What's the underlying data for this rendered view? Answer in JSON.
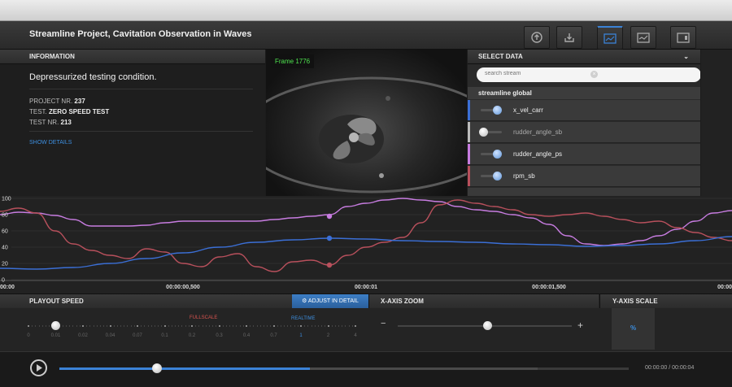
{
  "header": {
    "title": "Streamline Project, Cavitation Observation in Waves",
    "buttons": [
      {
        "icon": "upload-icon"
      },
      {
        "icon": "download-icon"
      },
      {
        "icon": "chart-panel-icon"
      },
      {
        "icon": "chart-line-icon"
      },
      {
        "icon": "window-icon"
      }
    ]
  },
  "info": {
    "heading": "INFORMATION",
    "headline": "Depressurized testing condition.",
    "project_label": "PROJECT NR. ",
    "project_value": "237",
    "test_label": "TEST. ",
    "test_value": "ZERO SPEED TEST",
    "testnr_label": "TEST NR. ",
    "testnr_value": "213",
    "show_details": "SHOW DETAILS"
  },
  "video": {
    "frame_label": "Frame 1776"
  },
  "select_data": {
    "heading": "SELECT DATA",
    "search_placeholder": "search stream",
    "group": "streamline global",
    "streams": [
      {
        "name": "x_vel_carr",
        "color": "#3b6fd6",
        "on": true
      },
      {
        "name": "rudder_angle_sb",
        "color": "#bbbbbb",
        "on": false
      },
      {
        "name": "rudder_angle_ps",
        "color": "#c77ce0",
        "on": true
      },
      {
        "name": "rpm_sb",
        "color": "#b8505c",
        "on": true
      }
    ]
  },
  "chart_data": {
    "type": "line",
    "ylim": [
      0,
      100
    ],
    "yticks": [
      "100",
      "80",
      "60",
      "40",
      "20",
      "0"
    ],
    "xticks": [
      "00:00",
      "00:00:00,500",
      "00:00:01",
      "00:00:01,500",
      "00:00"
    ],
    "x_range": [
      0,
      2
    ],
    "series": [
      {
        "name": "rudder_angle_ps",
        "color": "#c77ce0",
        "x": [
          0,
          0.05,
          0.1,
          0.15,
          0.2,
          0.25,
          0.3,
          0.35,
          0.4,
          0.45,
          0.5,
          0.55,
          0.6,
          0.65,
          0.7,
          0.75,
          0.8,
          0.85,
          0.9,
          0.95,
          1.0,
          1.05,
          1.1,
          1.15,
          1.2,
          1.25,
          1.3,
          1.35,
          1.4,
          1.45,
          1.5,
          1.55,
          1.6,
          1.65,
          1.7,
          1.75,
          1.8,
          1.85,
          1.9,
          1.95,
          2.0
        ],
        "y": [
          80,
          83,
          82,
          79,
          74,
          66,
          66,
          66,
          67,
          70,
          72,
          72,
          72,
          72,
          72,
          74,
          76,
          78,
          80,
          90,
          94,
          98,
          100,
          98,
          96,
          90,
          86,
          84,
          80,
          76,
          68,
          54,
          44,
          42,
          44,
          48,
          54,
          62,
          72,
          82,
          85
        ]
      },
      {
        "name": "rpm_sb",
        "color": "#b8505c",
        "x": [
          0,
          0.05,
          0.1,
          0.15,
          0.2,
          0.25,
          0.3,
          0.35,
          0.4,
          0.45,
          0.5,
          0.55,
          0.6,
          0.65,
          0.7,
          0.75,
          0.8,
          0.85,
          0.9,
          0.95,
          1.0,
          1.05,
          1.1,
          1.15,
          1.2,
          1.25,
          1.3,
          1.35,
          1.4,
          1.45,
          1.5,
          1.55,
          1.6,
          1.65,
          1.7,
          1.75,
          1.8,
          1.85,
          1.9,
          1.95,
          2.0
        ],
        "y": [
          84,
          88,
          82,
          60,
          44,
          36,
          30,
          26,
          38,
          34,
          20,
          16,
          28,
          32,
          16,
          10,
          22,
          24,
          18,
          30,
          40,
          46,
          52,
          70,
          92,
          98,
          94,
          90,
          86,
          80,
          78,
          80,
          82,
          78,
          74,
          70,
          72,
          64,
          58,
          52,
          48
        ]
      },
      {
        "name": "x_vel_carr",
        "color": "#3b6fd6",
        "x": [
          0,
          0.1,
          0.2,
          0.3,
          0.4,
          0.5,
          0.6,
          0.7,
          0.8,
          0.9,
          1.0,
          1.1,
          1.2,
          1.3,
          1.4,
          1.5,
          1.6,
          1.7,
          1.8,
          1.9,
          2.0
        ],
        "y": [
          14,
          13,
          15,
          20,
          26,
          33,
          40,
          46,
          49,
          51,
          50,
          48,
          47,
          46,
          44,
          43,
          41,
          42,
          44,
          48,
          53
        ]
      }
    ],
    "markers": [
      {
        "series": "rudder_angle_ps",
        "x": 0.9,
        "y": 78
      },
      {
        "series": "x_vel_carr",
        "x": 0.9,
        "y": 51
      },
      {
        "series": "rpm_sb",
        "x": 0.9,
        "y": 18
      }
    ]
  },
  "controls": {
    "playout_speed": "PLAYOUT SPEED",
    "adjust_label": "ADJUST IN DETAIL",
    "fullscale": "FULLSCALE",
    "realtime": "REALTIME",
    "speed_ticks": [
      "0",
      "0.01",
      "0.02",
      "0.04",
      "0.07",
      "0.1",
      "0.2",
      "0.3",
      "0.4",
      "0.7",
      "1",
      "2",
      "4"
    ],
    "speed_selected": "0.01",
    "xaxis_zoom": "X-AXIS ZOOM",
    "minus": "−",
    "plus": "+",
    "zoom_level": 0.52,
    "yaxis_scale": "Y-AXIS SCALE",
    "yaxis_value": "%",
    "colors": {
      "fullscale": "#d9534f",
      "realtime": "#3d8fe0"
    }
  },
  "playback": {
    "progress": 0.44,
    "buffered": 0.84,
    "timecode": "00:00:00 / 00:00:04"
  }
}
